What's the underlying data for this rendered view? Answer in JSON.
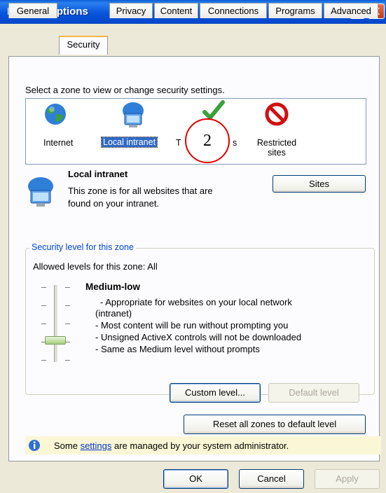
{
  "window": {
    "title": "Internet Options",
    "help_glyph": "?",
    "close_glyph": "X"
  },
  "tabs": [
    {
      "label": "General"
    },
    {
      "label": "Security"
    },
    {
      "label": "Privacy"
    },
    {
      "label": "Content"
    },
    {
      "label": "Connections"
    },
    {
      "label": "Programs"
    },
    {
      "label": "Advanced"
    }
  ],
  "zones": {
    "prompt": "Select a zone to view or change security settings.",
    "items": [
      {
        "label": "Internet",
        "icon": "globe-icon"
      },
      {
        "label": "Local intranet",
        "icon": "intranet-computer-icon",
        "selected": true
      },
      {
        "label": "T",
        "icon": "checkmark-icon"
      },
      {
        "label_line1": "Restricted",
        "label_line2": "sites",
        "icon": "no-entry-icon"
      }
    ],
    "partial_suffix": "s"
  },
  "zone_info": {
    "title": "Local intranet",
    "line1": "This zone is for all websites that are",
    "line2": "found on your intranet.",
    "sites_button": "Sites"
  },
  "security_level": {
    "group_title": "Security level for this zone",
    "allowed": "Allowed levels for this zone: All",
    "level_name": "Medium-low",
    "lines": [
      "- Appropriate for websites on your local network",
      "(intranet)",
      "- Most content will be run without prompting you",
      "- Unsigned ActiveX controls will not be downloaded",
      "- Same as Medium level without prompts"
    ],
    "slider_level": "Medium-low",
    "custom_button": "Custom level...",
    "default_button": "Default level"
  },
  "reset_button": "Reset all zones to default level",
  "info": {
    "prefix": "Some ",
    "link": "settings",
    "suffix": " are managed by your system administrator."
  },
  "footer": {
    "ok": "OK",
    "cancel": "Cancel",
    "apply": "Apply"
  },
  "annotation": {
    "number": "2"
  },
  "colors": {
    "titlebar": "#0855dd",
    "selection": "#316ac5",
    "group_title": "#0046d5",
    "marker": "#e00000"
  }
}
